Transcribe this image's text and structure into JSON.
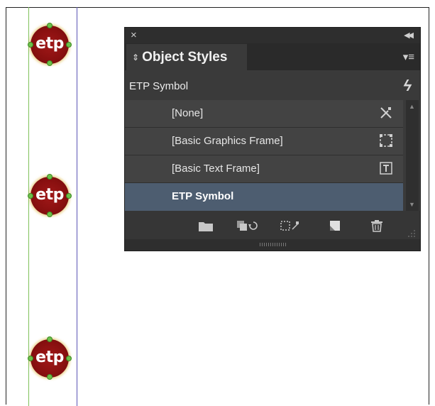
{
  "page": {
    "background": "#ffffff"
  },
  "panel": {
    "tab_label": "Object Styles",
    "current_style": "ETP Symbol",
    "colors": {
      "selected_row": "#4d5d70",
      "panel_bg": "#3a3a3a"
    },
    "styles": [
      {
        "label": "[None]",
        "icon": "none-style-icon"
      },
      {
        "label": "[Basic Graphics Frame]",
        "icon": "graphics-frame-icon"
      },
      {
        "label": "[Basic Text Frame]",
        "icon": "text-frame-icon"
      },
      {
        "label": "ETP Symbol",
        "icon": "",
        "selected": true
      }
    ],
    "bottom_icons": [
      "new-group-icon",
      "clear-overrides-icon",
      "clear-non-defined-icon",
      "new-style-icon",
      "delete-icon"
    ]
  },
  "symbols": [
    {
      "label": "etp"
    },
    {
      "label": "etp"
    },
    {
      "label": "etp"
    }
  ]
}
